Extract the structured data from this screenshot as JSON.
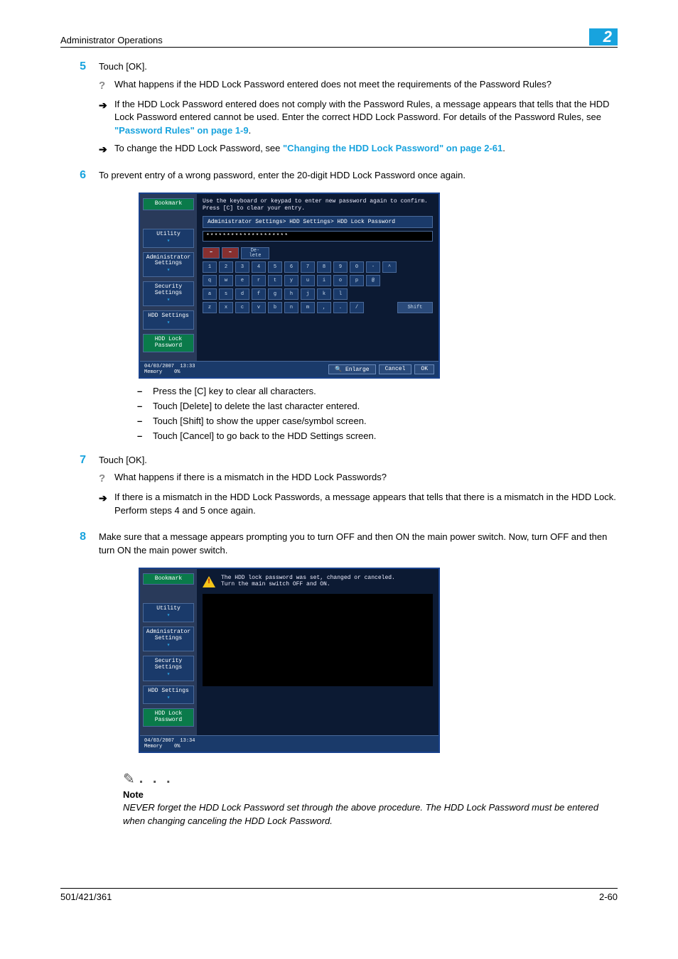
{
  "header": {
    "title": "Administrator Operations",
    "chapter": "2"
  },
  "steps": {
    "s5": {
      "num": "5",
      "text": "Touch [OK].",
      "q": "What happens if the HDD Lock Password entered does not meet the requirements of the Password Rules?",
      "a1_pre": "If the HDD Lock Password entered does not comply with the Password Rules, a message appears that tells that the HDD Lock Password entered cannot be used. Enter the correct HDD Lock Password. For details of the Password Rules, see ",
      "a1_link": "\"Password Rules\" on page 1-9",
      "a1_post": ".",
      "a2_pre": "To change the HDD Lock Password, see ",
      "a2_link": "\"Changing the HDD Lock Password\" on page 2-61",
      "a2_post": "."
    },
    "s6": {
      "num": "6",
      "text": "To prevent entry of a wrong password, enter the 20-digit HDD Lock Password once again.",
      "d1": "Press the [C] key to clear all characters.",
      "d2": "Touch [Delete] to delete the last character entered.",
      "d3": "Touch [Shift] to show the upper case/symbol screen.",
      "d4": "Touch [Cancel] to go back to the HDD Settings screen."
    },
    "s7": {
      "num": "7",
      "text": "Touch [OK].",
      "q": "What happens if there is a mismatch in the HDD Lock Passwords?",
      "a": "If there is a mismatch in the HDD Lock Passwords, a message appears that tells that there is a mismatch in the HDD Lock. Perform steps 4 and 5 once again."
    },
    "s8": {
      "num": "8",
      "text": "Make sure that a message appears prompting you to turn OFF and then ON the main power switch. Now, turn OFF and then turn ON the main power switch."
    }
  },
  "ss1": {
    "instr": "Use the keyboard or keypad to enter new password again to confirm.\nPress [C] to clear your entry.",
    "crumbs": {
      "bookmark": "Bookmark",
      "utility": "Utility",
      "admin": "Administrator Settings",
      "security": "Security Settings",
      "hdd": "HDD Settings",
      "lock": "HDD Lock Password"
    },
    "path": "Administrator Settings> HDD Settings> HDD Lock Password",
    "input": "********************",
    "keys": {
      "delete": "De-\nlete",
      "row1": [
        "1",
        "2",
        "3",
        "4",
        "5",
        "6",
        "7",
        "8",
        "9",
        "0",
        "-",
        "^"
      ],
      "row2": [
        "q",
        "w",
        "e",
        "r",
        "t",
        "y",
        "u",
        "i",
        "o",
        "p",
        "@"
      ],
      "row3": [
        "a",
        "s",
        "d",
        "f",
        "g",
        "h",
        "j",
        "k",
        "l"
      ],
      "row4": [
        "z",
        "x",
        "c",
        "v",
        "b",
        "n",
        "m",
        ",",
        ".",
        "/"
      ],
      "shift": "Shift"
    },
    "footer": {
      "date": "04/03/2007",
      "time": "13:33",
      "mem_label": "Memory",
      "mem_val": "0%",
      "enlarge": "Enlarge",
      "cancel": "Cancel",
      "ok": "OK"
    }
  },
  "ss2": {
    "msg": "The HDD lock password was set, changed or canceled.\nTurn the main switch OFF and ON.",
    "crumbs": {
      "bookmark": "Bookmark",
      "utility": "Utility",
      "admin": "Administrator Settings",
      "security": "Security Settings",
      "hdd": "HDD Settings",
      "lock": "HDD Lock Password"
    },
    "footer": {
      "date": "04/03/2007",
      "time": "13:34",
      "mem_label": "Memory",
      "mem_val": "0%"
    }
  },
  "note": {
    "heading": "Note",
    "text": "NEVER forget the HDD Lock Password set through the above procedure. The HDD Lock Password must be entered when changing canceling the HDD Lock Password."
  },
  "footer": {
    "left": "501/421/361",
    "right": "2-60"
  }
}
